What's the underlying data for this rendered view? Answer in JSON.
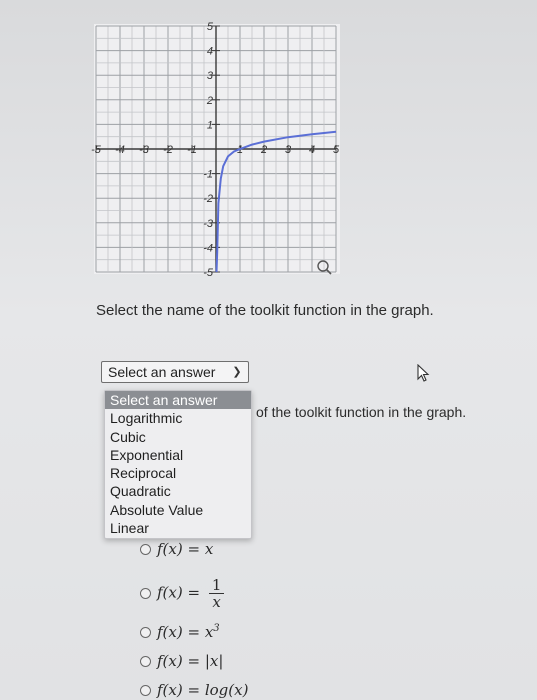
{
  "graph": {
    "x_ticks": [
      "-5",
      "-4",
      "-3",
      "-2",
      "-1",
      "1",
      "2",
      "3",
      "4",
      "5"
    ],
    "y_ticks": [
      "5",
      "4",
      "3",
      "2",
      "1",
      "-1",
      "-2",
      "-3",
      "-4",
      "-5"
    ],
    "zoom_icon": "magnifier-icon",
    "curve_color": "#5b6fd6"
  },
  "chart_data": {
    "type": "line",
    "title": "",
    "xlabel": "",
    "ylabel": "",
    "xlim": [
      -5,
      5
    ],
    "ylim": [
      -5,
      5
    ],
    "grid": true,
    "series": [
      {
        "x": [
          0.02,
          0.05,
          0.1,
          0.2,
          0.3,
          0.5,
          0.75,
          1,
          1.5,
          2,
          3,
          4,
          5
        ],
        "y": [
          -5,
          -4.2,
          -2.2,
          -1.2,
          -0.7,
          -0.3,
          -0.1,
          0,
          0.18,
          0.3,
          0.48,
          0.6,
          0.7
        ]
      }
    ]
  },
  "question": {
    "prompt": "Select the name of the toolkit function in the graph.",
    "behind_text": "of the toolkit function in the graph."
  },
  "select": {
    "current": "Select an answer",
    "options": [
      "Select an answer",
      "Logarithmic",
      "Cubic",
      "Exponential",
      "Reciprocal",
      "Quadratic",
      "Absolute Value",
      "Linear"
    ]
  },
  "choices": [
    {
      "lhs": "f(x) = ",
      "rhs": "x"
    },
    {
      "lhs": "f(x) = ",
      "num": "1",
      "den": "x"
    },
    {
      "lhs": "f(x) = ",
      "rhs": "x",
      "sup": "3"
    },
    {
      "lhs": "f(x) = ",
      "rhs": "|x|"
    },
    {
      "lhs": "f(x) = ",
      "rhs": "log(x)"
    }
  ]
}
